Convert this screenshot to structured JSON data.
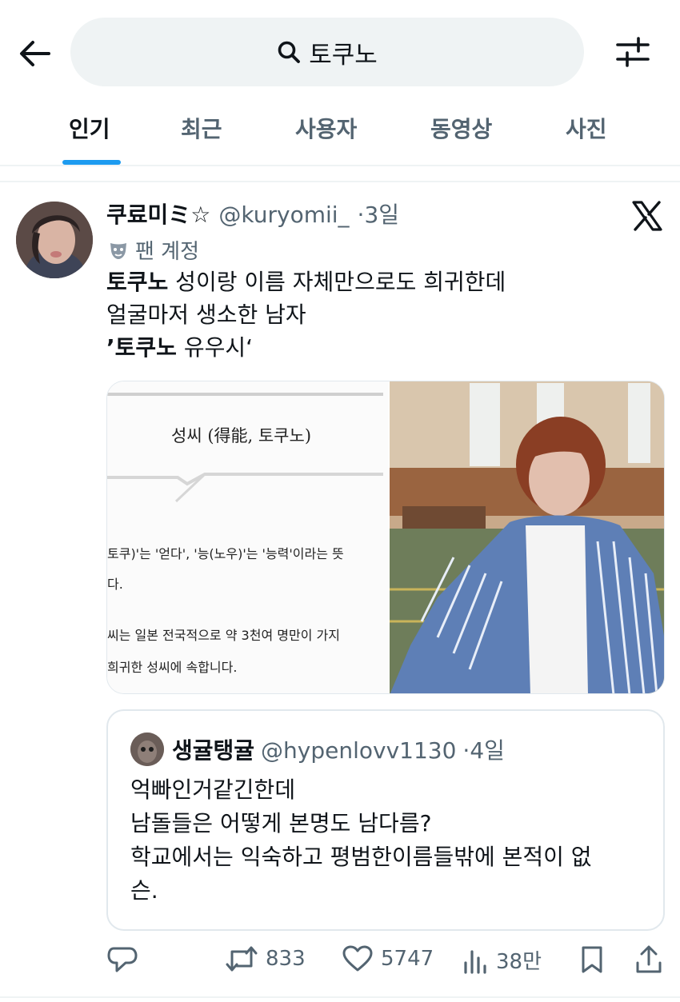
{
  "search": {
    "query": "토쿠노"
  },
  "tabs": [
    {
      "label": "인기",
      "active": true
    },
    {
      "label": "최근",
      "active": false
    },
    {
      "label": "사용자",
      "active": false
    },
    {
      "label": "동영상",
      "active": false
    },
    {
      "label": "사진",
      "active": false
    }
  ],
  "tweet": {
    "display_name": "쿠료미ミ☆",
    "handle": "@kuryomii_",
    "time": "·3일",
    "badge": "팬 계정",
    "text_line1_bold": "토쿠노",
    "text_line1_rest": " 성이랑 이름 자체만으로도 희귀한데",
    "text_line2": "얼굴마저 생소한 남자",
    "text_line3_prefix": "’",
    "text_line3_bold": "토쿠노",
    "text_line3_rest": " 유우시‘",
    "media_doc": {
      "title": "성씨 (得能, 토쿠노)",
      "line1": "토쿠)'는 '얻다', '능(노우)'는 '능력'이라는 뜻",
      "line2": "다.",
      "line3": "씨는 일본 전국적으로 약 3천여 명만이 가지",
      "line4": "희귀한 성씨에 속합니다."
    }
  },
  "quote": {
    "display_name": "생귤탱귤",
    "handle": "@hypenlovv1130",
    "time": "·4일",
    "line1": "억빠인거같긴한데",
    "line2": "남돌들은 어떻게 본명도 남다름?",
    "line3": "학교에서는 익숙하고 평범한이름들밖에 본적이 없",
    "line4": "슨."
  },
  "actions": {
    "retweets": "833",
    "likes": "5747",
    "views": "38만"
  },
  "colors": {
    "accent": "#1d9bf0",
    "secondary_text": "#536471",
    "search_bg": "#eff3f4"
  }
}
